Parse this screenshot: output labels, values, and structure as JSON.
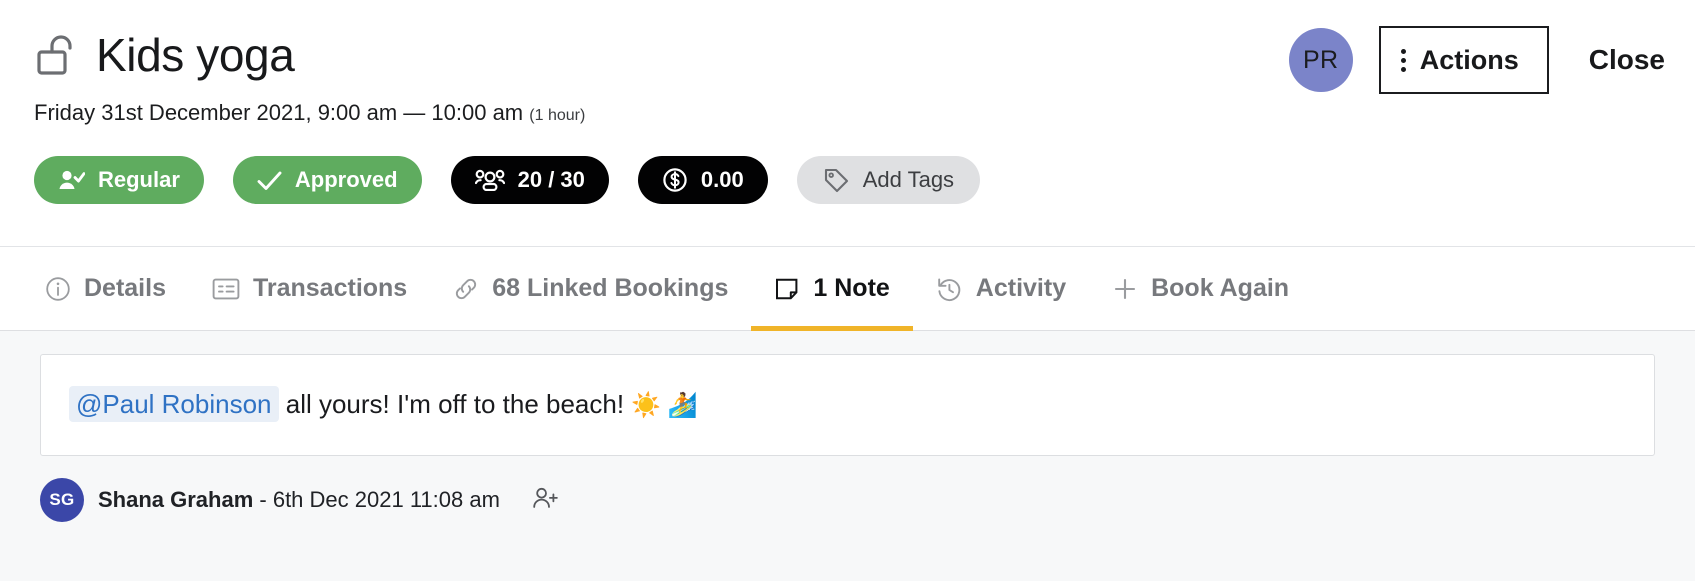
{
  "header": {
    "title": "Kids yoga",
    "lock_icon": "unlocked-padlock-icon",
    "datetime": "Friday 31st December 2021, 9:00 am — 10:00 am",
    "duration": "(1 hour)",
    "avatar_initials": "PR",
    "actions_label": "Actions",
    "close_label": "Close"
  },
  "badges": [
    {
      "id": "regular",
      "label": "Regular",
      "icon": "person-check-icon",
      "style": "green"
    },
    {
      "id": "approved",
      "label": "Approved",
      "icon": "check-icon",
      "style": "green"
    },
    {
      "id": "capacity",
      "label": "20 / 30",
      "icon": "people-icon",
      "style": "dark"
    },
    {
      "id": "amount",
      "label": "0.00",
      "icon": "dollar-circle-icon",
      "style": "dark"
    },
    {
      "id": "tags",
      "label": "Add Tags",
      "icon": "tag-icon",
      "style": "gray"
    }
  ],
  "tabs": [
    {
      "id": "details",
      "label": "Details",
      "icon": "info-circle-icon",
      "active": false
    },
    {
      "id": "transactions",
      "label": "Transactions",
      "icon": "receipt-icon",
      "active": false
    },
    {
      "id": "linked",
      "label": "68 Linked Bookings",
      "icon": "link-icon",
      "active": false
    },
    {
      "id": "note",
      "label": "1 Note",
      "icon": "note-icon",
      "active": true
    },
    {
      "id": "activity",
      "label": "Activity",
      "icon": "history-icon",
      "active": false
    },
    {
      "id": "book-again",
      "label": "Book Again",
      "icon": "plus-icon",
      "active": false
    }
  ],
  "note": {
    "mention": "@Paul Robinson",
    "text": " all yours! I'm off to the beach! ",
    "emoji": "☀️ 🏄",
    "author": "Shana Graham",
    "timestamp": " - 6th Dec 2021 11:08 am",
    "assign_icon": "add-person-icon"
  },
  "colors": {
    "accent_tab": "#f0b429",
    "green_pill": "#5fac5f",
    "dark_pill": "#020203",
    "gray_pill": "#dfe0e2",
    "avatar_pr": "#7b84c9",
    "avatar_sg": "#3b47a8",
    "mention_text": "#2f72c4",
    "mention_bg": "#e9eff7"
  }
}
